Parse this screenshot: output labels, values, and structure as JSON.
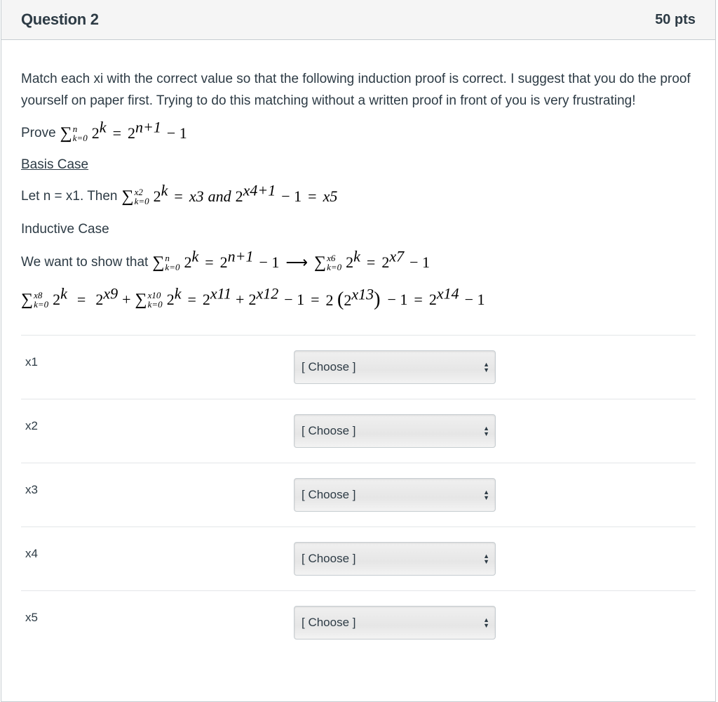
{
  "header": {
    "title": "Question 2",
    "points": "50 pts"
  },
  "intro": "Match each xi with the correct value so that the following induction proof is correct.  I suggest that you do the proof yourself on paper first.  Trying to do this matching without a written proof in front of you is very frustrating!",
  "prove": {
    "label": "Prove",
    "upper": "n",
    "lower": "k=0",
    "base": "2",
    "exp": "k",
    "eq": "=",
    "rhs_base": "2",
    "rhs_exp": "n+1",
    "minus_one": "− 1"
  },
  "basis": {
    "heading": "Basis Case",
    "text": "Let n = x1. Then",
    "upper": "x2",
    "lower": "k=0",
    "term_exp": "k",
    "x3": "x3",
    "and": "and",
    "exp": "x4+1",
    "minus_one": "− 1",
    "x5": "x5"
  },
  "inductive": {
    "heading": "Inductive Case",
    "text": "We want to show that",
    "line1": {
      "upper1": "n",
      "lower": "k=0",
      "exp_k": "k",
      "rhs_exp1": "n+1",
      "arrow": "⟶",
      "upper2": "x6",
      "rhs_exp2": "x7"
    },
    "line2": {
      "upper1": "x8",
      "lower": "k=0",
      "exp_k": "k",
      "e9": "x9",
      "upper2": "x10",
      "e11": "x11",
      "e12": "x12",
      "e13": "x13",
      "e14": "x14"
    }
  },
  "matching": {
    "rows": [
      {
        "label": "x1",
        "value": "[ Choose ]"
      },
      {
        "label": "x2",
        "value": "[ Choose ]"
      },
      {
        "label": "x3",
        "value": "[ Choose ]"
      },
      {
        "label": "x4",
        "value": "[ Choose ]"
      },
      {
        "label": "x5",
        "value": "[ Choose ]"
      }
    ]
  }
}
